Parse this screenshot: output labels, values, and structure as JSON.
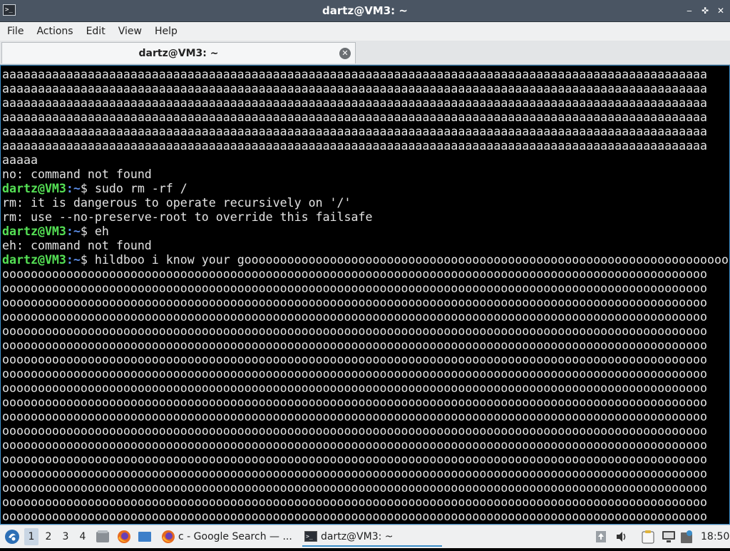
{
  "window": {
    "title": "dartz@VM3: ~",
    "buttons": {
      "minimize": "‒",
      "maximize": "✜",
      "close": "✕"
    }
  },
  "menu": [
    "File",
    "Actions",
    "Edit",
    "View",
    "Help"
  ],
  "tab": {
    "label": "dartz@VM3: ~"
  },
  "terminal": {
    "lines": [
      {
        "text": "aaaaaaaaaaaaaaaaaaaaaaaaaaaaaaaaaaaaaaaaaaaaaaaaaaaaaaaaaaaaaaaaaaaaaaaaaaaaaaaaaaaaaaaaaaaaaaaaaaa"
      },
      {
        "text": "aaaaaaaaaaaaaaaaaaaaaaaaaaaaaaaaaaaaaaaaaaaaaaaaaaaaaaaaaaaaaaaaaaaaaaaaaaaaaaaaaaaaaaaaaaaaaaaaaaa"
      },
      {
        "text": "aaaaaaaaaaaaaaaaaaaaaaaaaaaaaaaaaaaaaaaaaaaaaaaaaaaaaaaaaaaaaaaaaaaaaaaaaaaaaaaaaaaaaaaaaaaaaaaaaaa"
      },
      {
        "text": "aaaaaaaaaaaaaaaaaaaaaaaaaaaaaaaaaaaaaaaaaaaaaaaaaaaaaaaaaaaaaaaaaaaaaaaaaaaaaaaaaaaaaaaaaaaaaaaaaaa"
      },
      {
        "text": "aaaaaaaaaaaaaaaaaaaaaaaaaaaaaaaaaaaaaaaaaaaaaaaaaaaaaaaaaaaaaaaaaaaaaaaaaaaaaaaaaaaaaaaaaaaaaaaaaaa"
      },
      {
        "text": "aaaaaaaaaaaaaaaaaaaaaaaaaaaaaaaaaaaaaaaaaaaaaaaaaaaaaaaaaaaaaaaaaaaaaaaaaaaaaaaaaaaaaaaaaaaaaaaaaaa"
      },
      {
        "text": "aaaaa"
      },
      {
        "text": "no: command not found"
      },
      {
        "prompt": true,
        "user": "dartz@VM3",
        "path": ":~",
        "text": "$ sudo rm -rf /"
      },
      {
        "text": "rm: it is dangerous to operate recursively on '/'"
      },
      {
        "text": "rm: use --no-preserve-root to override this failsafe"
      },
      {
        "prompt": true,
        "user": "dartz@VM3",
        "path": ":~",
        "text": "$ eh"
      },
      {
        "text": "eh: command not found"
      },
      {
        "prompt": true,
        "user": "dartz@VM3",
        "path": ":~",
        "text": "$ hildboo i know your gooooooooooooooooooooooooooooooooooooooooooooooooooooooooooooooooooooooooooo"
      },
      {
        "text": "ooooooooooooooooooooooooooooooooooooooooooooooooooooooooooooooooooooooooooooooooooooooooooooooooooo"
      },
      {
        "text": "ooooooooooooooooooooooooooooooooooooooooooooooooooooooooooooooooooooooooooooooooooooooooooooooooooo"
      },
      {
        "text": "ooooooooooooooooooooooooooooooooooooooooooooooooooooooooooooooooooooooooooooooooooooooooooooooooooo"
      },
      {
        "text": "ooooooooooooooooooooooooooooooooooooooooooooooooooooooooooooooooooooooooooooooooooooooooooooooooooo"
      },
      {
        "text": "ooooooooooooooooooooooooooooooooooooooooooooooooooooooooooooooooooooooooooooooooooooooooooooooooooo"
      },
      {
        "text": "ooooooooooooooooooooooooooooooooooooooooooooooooooooooooooooooooooooooooooooooooooooooooooooooooooo"
      },
      {
        "text": "ooooooooooooooooooooooooooooooooooooooooooooooooooooooooooooooooooooooooooooooooooooooooooooooooooo"
      },
      {
        "text": "ooooooooooooooooooooooooooooooooooooooooooooooooooooooooooooooooooooooooooooooooooooooooooooooooooo"
      },
      {
        "text": "ooooooooooooooooooooooooooooooooooooooooooooooooooooooooooooooooooooooooooooooooooooooooooooooooooo"
      },
      {
        "text": "ooooooooooooooooooooooooooooooooooooooooooooooooooooooooooooooooooooooooooooooooooooooooooooooooooo"
      },
      {
        "text": "ooooooooooooooooooooooooooooooooooooooooooooooooooooooooooooooooooooooooooooooooooooooooooooooooooo"
      },
      {
        "text": "ooooooooooooooooooooooooooooooooooooooooooooooooooooooooooooooooooooooooooooooooooooooooooooooooooo"
      },
      {
        "text": "ooooooooooooooooooooooooooooooooooooooooooooooooooooooooooooooooooooooooooooooooooooooooooooooooooo"
      },
      {
        "text": "ooooooooooooooooooooooooooooooooooooooooooooooooooooooooooooooooooooooooooooooooooooooooooooooooooo"
      },
      {
        "text": "ooooooooooooooooooooooooooooooooooooooooooooooooooooooooooooooooooooooooooooooooooooooooooooooooooo"
      },
      {
        "text": "ooooooooooooooooooooooooooooooooooooooooooooooooooooooooooooooooooooooooooooooooooooooooooooooooooo"
      },
      {
        "text": "ooooooooooooooooooooooooooooooooooooooooooooooooooooooooooooooooooooooooooooooooooooooooooooooooooo"
      },
      {
        "text": "ooooooooooooooooooooooooooooooooooooooooooooooooooooooooooooooooooooooooooooooooooooooooooooooooooo"
      }
    ]
  },
  "taskbar": {
    "desktops": [
      "1",
      "2",
      "3",
      "4"
    ],
    "tasks": [
      {
        "label": "c - Google Search — ...",
        "icon": "firefox-icon"
      },
      {
        "label": "dartz@VM3: ~",
        "icon": "terminal-icon"
      }
    ],
    "clock": "18:50"
  },
  "colors": {
    "prompt_user": "#55e155",
    "prompt_path": "#5c8ee8",
    "terminal_bg": "#000000",
    "titlebar_bg": "#4a5563",
    "accent": "#3c8ec9"
  }
}
